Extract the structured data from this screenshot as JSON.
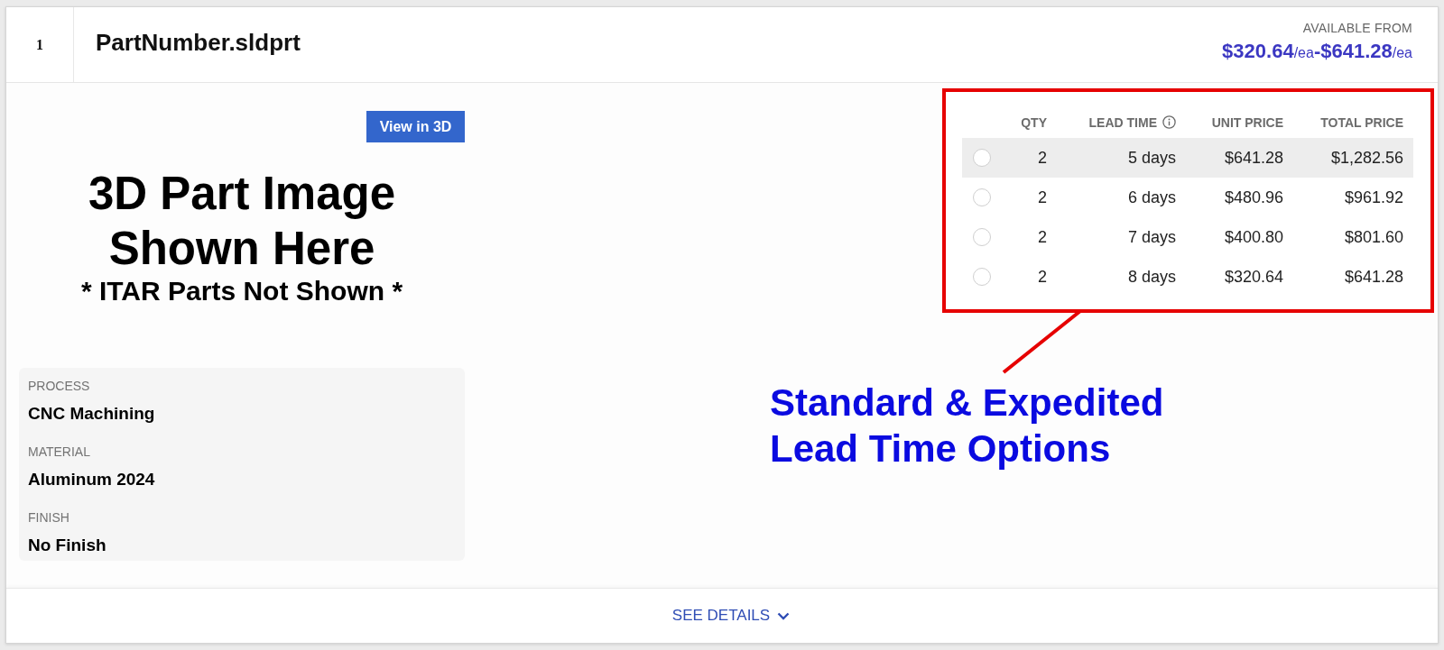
{
  "item": {
    "index": "1",
    "file_name": "PartNumber.sldprt",
    "price_label": "AVAILABLE FROM",
    "price_range": "**$320.64**/ea**-$641.28**/ea"
  },
  "viewer": {
    "button": "View in 3D",
    "image_title": "3D Part Image Shown Here",
    "image_note": "* ITAR Parts Not Shown *"
  },
  "specs": [
    {
      "label": "PROCESS",
      "value": "CNC Machining"
    },
    {
      "label": "MATERIAL",
      "value": "Aluminum 2024"
    },
    {
      "label": "FINISH",
      "value": "No Finish"
    }
  ],
  "table": {
    "columns": [
      {
        "label": "QTY",
        "kind": "plain"
      },
      {
        "label": "LEAD TIME",
        "kind": "info"
      },
      {
        "label": "UNIT PRICE",
        "kind": "plain"
      },
      {
        "label": "TOTAL PRICE",
        "kind": "plain"
      }
    ],
    "rows": [
      {
        "qty": "2",
        "lead_time": "5 days",
        "unit_price": "$641.28",
        "total_price": "$1,282.56",
        "selected": false,
        "highlighted": true
      },
      {
        "qty": "2",
        "lead_time": "6 days",
        "unit_price": "$480.96",
        "total_price": "$961.92",
        "selected": false,
        "highlighted": false
      },
      {
        "qty": "2",
        "lead_time": "7 days",
        "unit_price": "$400.80",
        "total_price": "$801.60",
        "selected": false,
        "highlighted": false
      },
      {
        "qty": "2",
        "lead_time": "8 days",
        "unit_price": "$320.64",
        "total_price": "$641.28",
        "selected": false,
        "highlighted": false
      }
    ]
  },
  "annotation": {
    "text": "Standard & Expedited Lead Time Options"
  },
  "footer": {
    "link": "SEE DETAILS"
  }
}
